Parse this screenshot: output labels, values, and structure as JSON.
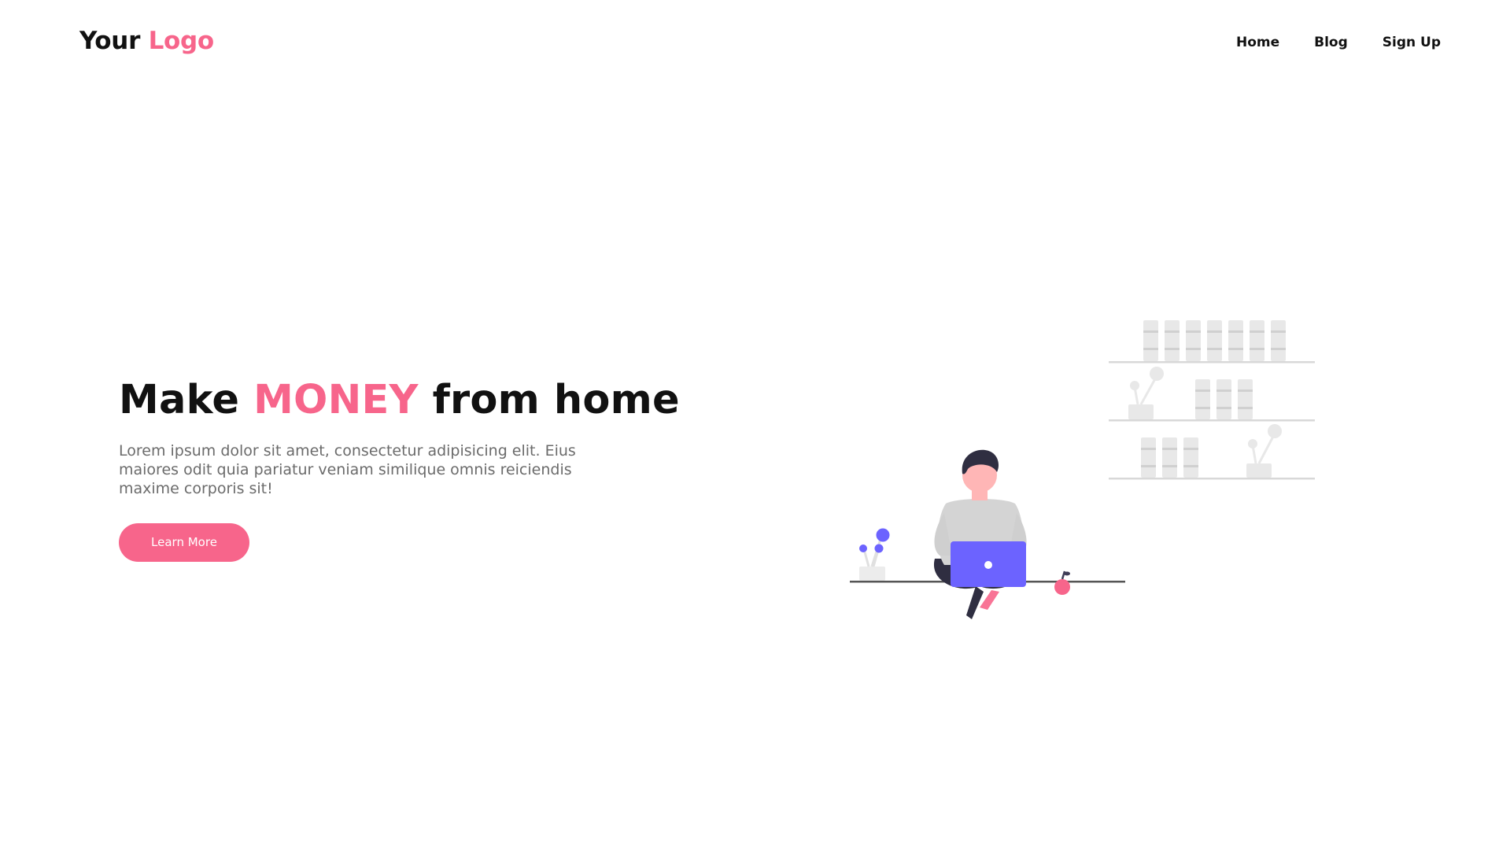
{
  "header": {
    "logo_part1": "Your",
    "logo_part2": "Logo",
    "nav": [
      {
        "label": "Home"
      },
      {
        "label": "Blog"
      },
      {
        "label": "Sign Up"
      }
    ]
  },
  "hero": {
    "headline_before": "Make",
    "headline_accent": "MONEY",
    "headline_after": "from home",
    "description": "Lorem ipsum dolor sit amet, consectetur adipisicing elit. Eius maiores odit quia pariatur veniam similique omnis reiciendis maxime corporis sit!",
    "cta_label": "Learn More"
  },
  "colors": {
    "accent": "#f7658b",
    "text": "#111111",
    "muted_text": "#6b6b6b",
    "illustration_purple": "#6c63ff"
  },
  "illustration": {
    "icon": "person-with-laptop-illustration"
  }
}
